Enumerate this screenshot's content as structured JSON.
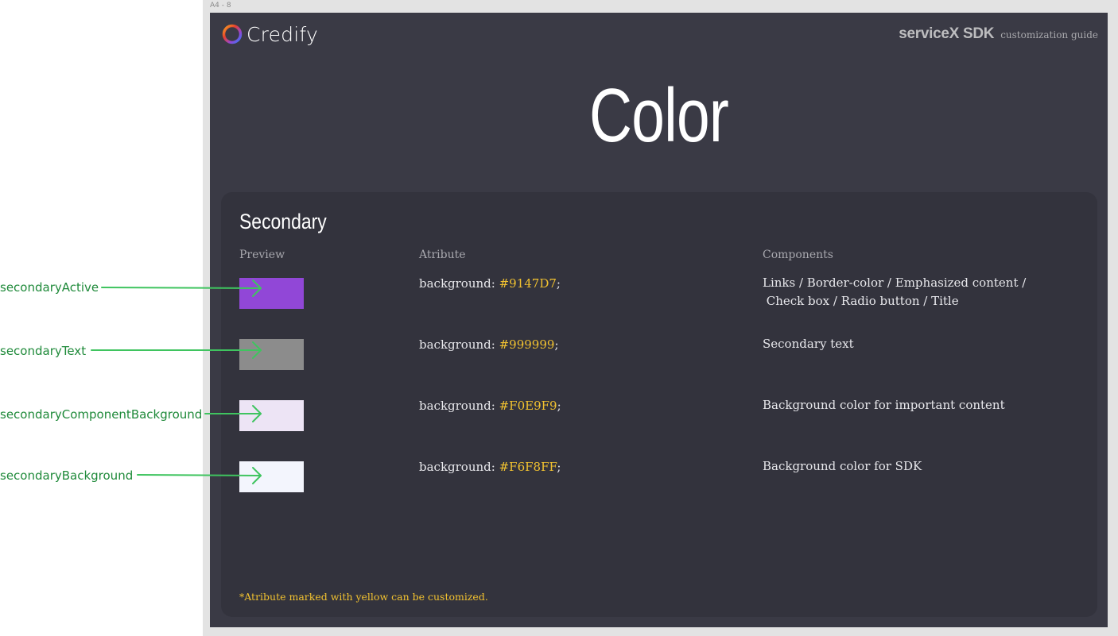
{
  "frame_label": "A4 - 8",
  "logo": {
    "text": "Credify"
  },
  "brand": {
    "main": "serviceX SDK",
    "sub": "customization guide"
  },
  "page_title": "Color",
  "section": {
    "title": "Secondary",
    "columns": {
      "preview": "Preview",
      "attribute": "Atribute",
      "components": "Components"
    },
    "rows": [
      {
        "attr_prefix": "background: ",
        "hex": "#9147D7",
        "suffix": ";",
        "swatch_color": "#9147D7",
        "components_line1": "Links / Border-color / Emphasized content /",
        "components_line2": " Check box / Radio button / Title",
        "annotation": "secondaryActive"
      },
      {
        "attr_prefix": "background: ",
        "hex": "#999999",
        "suffix": ";",
        "swatch_color": "#8c8c8c",
        "components_line1": "Secondary text",
        "components_line2": "",
        "annotation": "secondaryText"
      },
      {
        "attr_prefix": "background: ",
        "hex": "#F0E9F9",
        "suffix": ";",
        "swatch_color": "#ede4f5",
        "components_line1": "Background color for important content",
        "components_line2": "",
        "annotation": "secondaryComponentBackground"
      },
      {
        "attr_prefix": "background: ",
        "hex": "#F6F8FF",
        "suffix": ";",
        "swatch_color": "#f3f5fd",
        "components_line1": "Background color for SDK",
        "components_line2": "",
        "annotation": "secondaryBackground"
      }
    ],
    "footnote": "*Atribute marked with yellow can be customized."
  },
  "colors": {
    "frame_bg": "#3a3a45",
    "panel_bg": "#33333d",
    "highlight": "#f2c230",
    "annotation": "#1f8a3a",
    "arrow": "#3fc45f"
  },
  "icons": {
    "logo": "credify-ring-icon",
    "arrow": "arrow-right-icon"
  }
}
